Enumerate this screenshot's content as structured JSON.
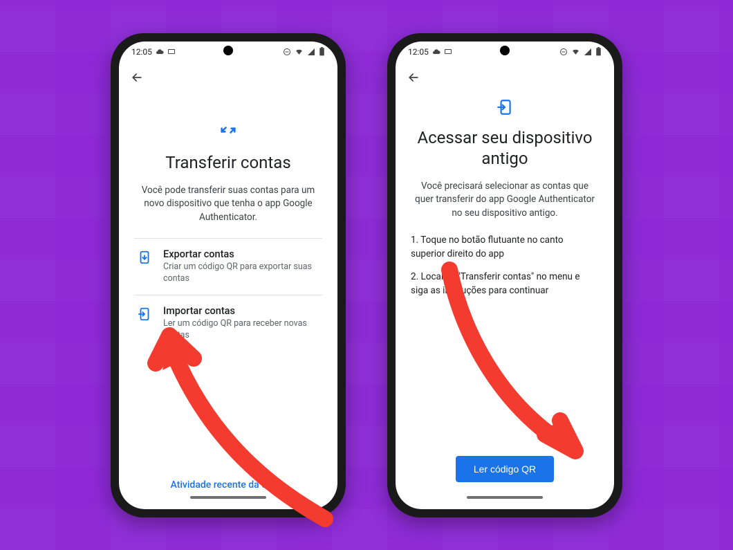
{
  "status": {
    "time": "12:05",
    "icons_left": [
      "cloud-icon",
      "cast-icon"
    ],
    "icons_right": [
      "dnd-icon",
      "wifi-icon",
      "signal-icon",
      "battery-icon"
    ]
  },
  "phone1": {
    "title": "Transferir contas",
    "subtitle": "Você pode transferir suas contas para um novo dispositivo que tenha o app Google Authenticator.",
    "options": [
      {
        "title": "Exportar contas",
        "desc": "Criar um código QR para exportar suas contas"
      },
      {
        "title": "Importar contas",
        "desc": "Ler um código QR para receber novas contas"
      }
    ],
    "footer_link": "Atividade recente da conta"
  },
  "phone2": {
    "title": "Acessar seu dispositivo antigo",
    "subtitle": "Você precisará selecionar as contas que quer transferir do app Google Authenticator no seu dispositivo antigo.",
    "steps": [
      "1. Toque no botão flutuante no canto superior direito do app",
      "2. Localize \"Transferir contas\" no menu e siga as instruções para continuar"
    ],
    "button": "Ler código QR"
  },
  "colors": {
    "accent": "#1a73e8",
    "annotation": "#f33b2f"
  }
}
